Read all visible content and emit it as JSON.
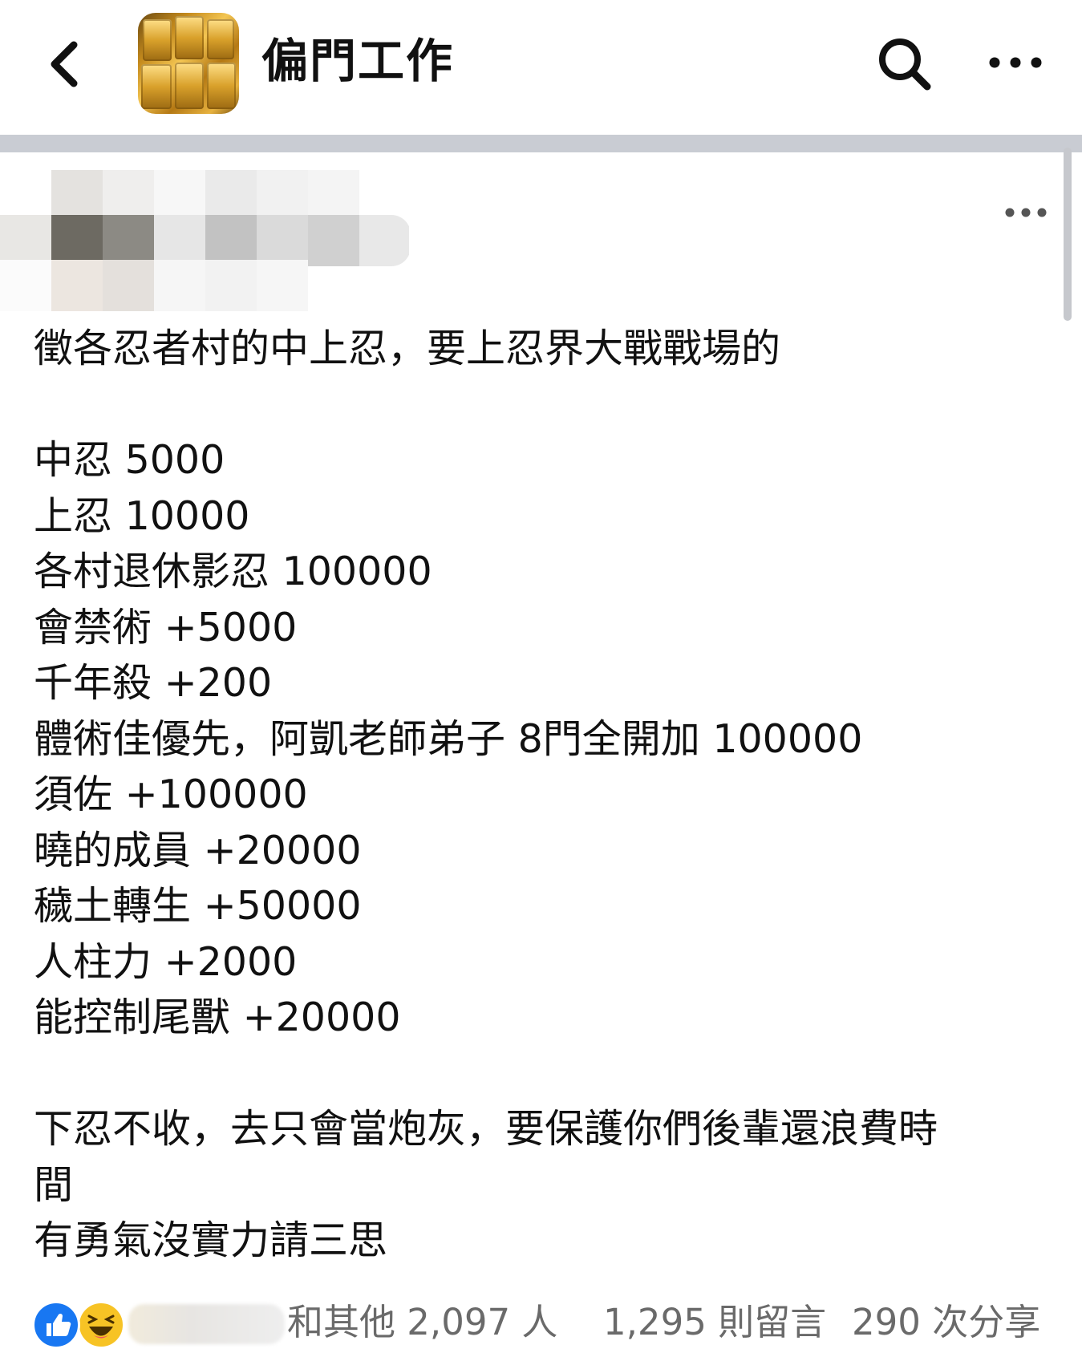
{
  "header": {
    "back_icon": "chevron-left-icon",
    "group_name": "偏門工作",
    "search_icon": "search-icon",
    "more_icon": "more-horizontal-icon"
  },
  "post": {
    "more_icon": "more-horizontal-icon",
    "lines": [
      "徵各忍者村的中上忍，要上忍界大戰戰場的",
      "",
      "中忍 5000",
      "上忍 10000",
      "各村退休影忍 100000",
      "會禁術 +5000",
      "千年殺 +200",
      "體術佳優先，阿凱老師弟子 8門全開加 100000",
      "須佐 +100000",
      "曉的成員 +20000",
      "穢土轉生 +50000",
      "人柱力 +2000",
      "能控制尾獸 +20000",
      "",
      "下忍不收，去只會當炮灰，要保護你們後輩還浪費時",
      "間",
      "有勇氣沒實力請三思"
    ]
  },
  "footer": {
    "reaction_icons": [
      "like-icon",
      "haha-icon"
    ],
    "reactions_text": "和其他 2,097 人",
    "comments_text": "1,295 則留言",
    "shares_text": "290 次分享"
  },
  "colors": {
    "like_blue": "#1877f2",
    "haha_yellow": "#f7c325",
    "separator_gray": "#c9ccd3",
    "meta_text": "#6a6a6a"
  }
}
